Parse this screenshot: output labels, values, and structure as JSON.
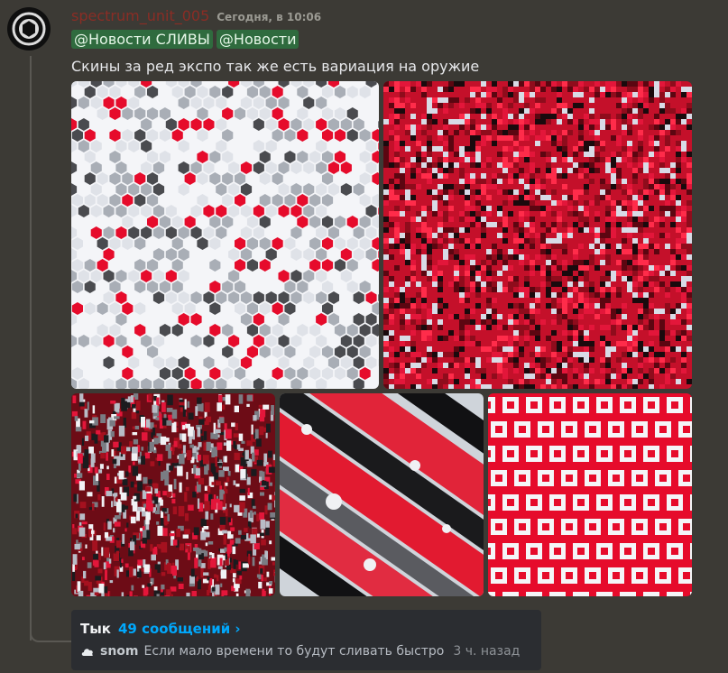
{
  "message": {
    "username": "spectrum_unit_005",
    "timestamp": "Сегодня, в 10:06",
    "mentions": [
      "@Новости СЛИВЫ",
      "@Новости"
    ],
    "text": "Скины за ред экспо так же есть вариация на оружие"
  },
  "attachments": [
    {
      "name": "hex-camo-white"
    },
    {
      "name": "digital-camo-red"
    },
    {
      "name": "splatter-camo-red-gray"
    },
    {
      "name": "brush-stroke-camo"
    },
    {
      "name": "red-squares-pattern"
    }
  ],
  "thread": {
    "title": "Тык",
    "count": "49 сообщений ›",
    "last_user": "snom",
    "last_message": "Если мало времени то будут сливать быстро",
    "last_time": "3 ч. назад"
  },
  "colors": {
    "red": "#e60b2b",
    "dark_gray": "#4a4b4f",
    "gray": "#a9aeb6",
    "white": "#f4f5f8",
    "link_blue": "#00a8fc",
    "mention_bg": "#2f6b3e"
  }
}
